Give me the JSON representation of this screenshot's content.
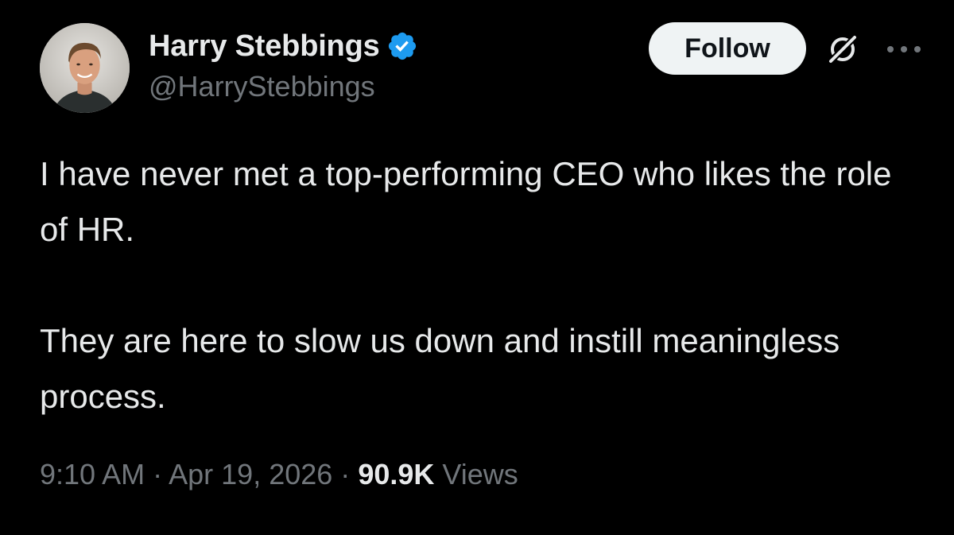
{
  "author": {
    "display_name": "Harry Stebbings",
    "handle": "@HarryStebbings",
    "verified": true,
    "verified_color": "#1d9bf0"
  },
  "actions": {
    "follow_label": "Follow",
    "grok_icon": "grok-icon",
    "more_icon": "more-options-icon"
  },
  "tweet": {
    "paragraphs": [
      "I have never met a top-performing CEO who likes the role of HR.",
      "They are here to slow us down and instill meaningless process."
    ]
  },
  "meta": {
    "time": "9:10 AM",
    "separator": "·",
    "date": "Apr 19, 2026",
    "views_count": "90.9K",
    "views_label": "Views"
  },
  "colors": {
    "background": "#000000",
    "primary_text": "#e7e9ea",
    "secondary_text": "#71767b",
    "follow_bg": "#eff3f4"
  }
}
